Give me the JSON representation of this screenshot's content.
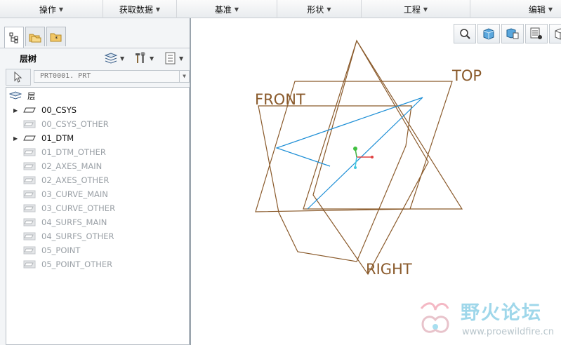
{
  "menubar": {
    "items": [
      {
        "label": "操作"
      },
      {
        "label": "获取数据"
      },
      {
        "label": "基准"
      },
      {
        "label": "形状"
      },
      {
        "label": "工程"
      },
      {
        "label": "编辑"
      }
    ]
  },
  "navigator": {
    "tabs": [
      "model-tree-icon",
      "folder-browser-icon",
      "favorites-icon"
    ],
    "active_tab": 0
  },
  "layer_tree": {
    "title": "层树",
    "model_select": "PRT0001. PRT",
    "root_label": "层",
    "items": [
      {
        "label": "00_CSYS",
        "expandable": true,
        "visible": true
      },
      {
        "label": "00_CSYS_OTHER",
        "expandable": false,
        "visible": false
      },
      {
        "label": "01_DTM",
        "expandable": true,
        "visible": true
      },
      {
        "label": "01_DTM_OTHER",
        "expandable": false,
        "visible": false
      },
      {
        "label": "02_AXES_MAIN",
        "expandable": false,
        "visible": false
      },
      {
        "label": "02_AXES_OTHER",
        "expandable": false,
        "visible": false
      },
      {
        "label": "03_CURVE_MAIN",
        "expandable": false,
        "visible": false
      },
      {
        "label": "03_CURVE_OTHER",
        "expandable": false,
        "visible": false
      },
      {
        "label": "04_SURFS_MAIN",
        "expandable": false,
        "visible": false
      },
      {
        "label": "04_SURFS_OTHER",
        "expandable": false,
        "visible": false
      },
      {
        "label": "05_POINT",
        "expandable": false,
        "visible": false
      },
      {
        "label": "05_POINT_OTHER",
        "expandable": false,
        "visible": false
      }
    ]
  },
  "graphics": {
    "datum_labels": {
      "front": "FRONT",
      "top": "TOP",
      "right": "RIGHT"
    },
    "datum_color": "#8a5a2b",
    "curve_color": "#1e8fd6",
    "view_toolbar": [
      "zoom-icon",
      "cube-icon",
      "saved-view-icon",
      "layer-display-icon",
      "view-cube-icon"
    ]
  },
  "watermark": {
    "text": "野火论坛",
    "url": "www.proewildfire.cn"
  }
}
